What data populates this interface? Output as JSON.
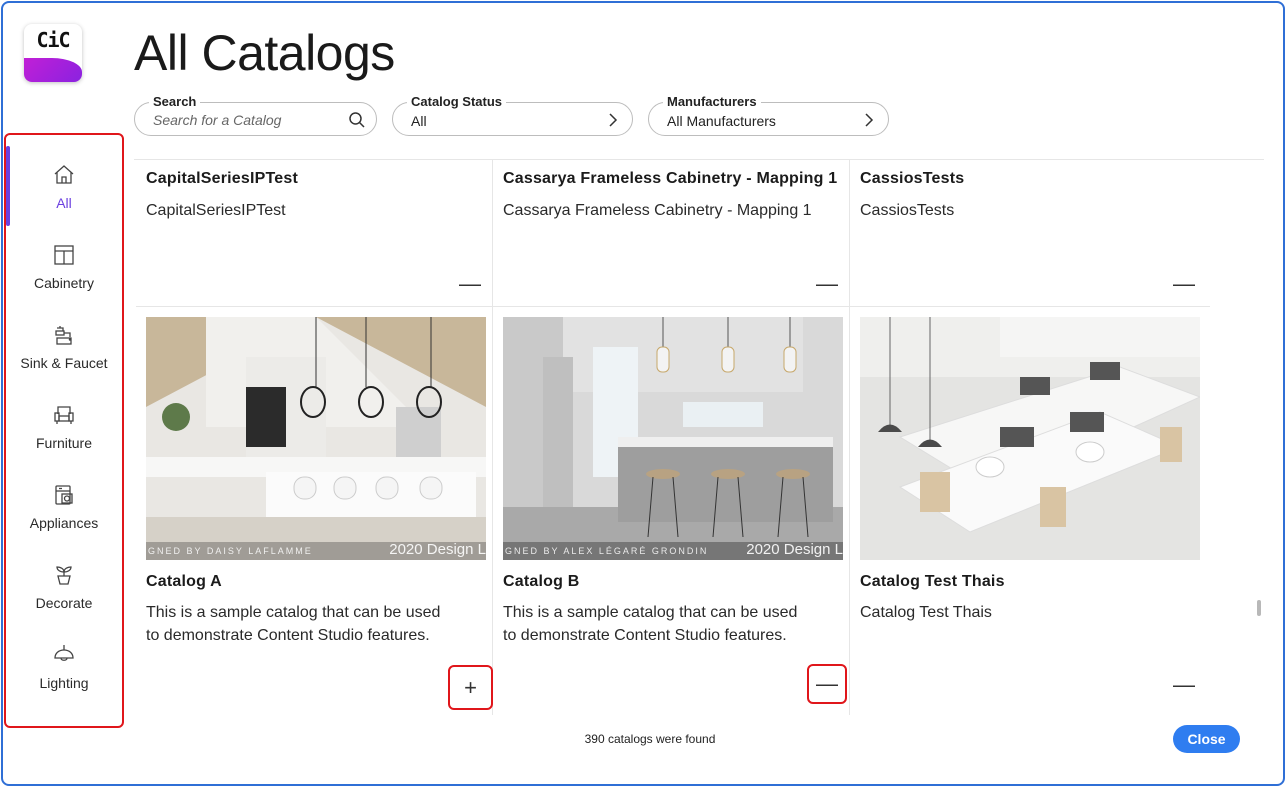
{
  "app": {
    "logo_text": "CiC"
  },
  "page": {
    "title": "All Catalogs"
  },
  "filters": {
    "search": {
      "label": "Search",
      "placeholder": "Search for a Catalog"
    },
    "status": {
      "label": "Catalog Status",
      "value": "All"
    },
    "manufacturers": {
      "label": "Manufacturers",
      "value": "All Manufacturers"
    }
  },
  "sidebar": {
    "items": [
      {
        "label": "All",
        "icon": "home-icon",
        "active": true
      },
      {
        "label": "Cabinetry",
        "icon": "cabinet-icon"
      },
      {
        "label": "Sink & Faucet",
        "icon": "faucet-icon"
      },
      {
        "label": "Furniture",
        "icon": "armchair-icon"
      },
      {
        "label": "Appliances",
        "icon": "appliance-icon"
      },
      {
        "label": "Decorate",
        "icon": "plant-icon"
      },
      {
        "label": "Lighting",
        "icon": "lamp-icon"
      }
    ]
  },
  "catalogs": [
    {
      "title": "CapitalSeriesIPTest",
      "description": "CapitalSeriesIPTest",
      "action": "—"
    },
    {
      "title": "Cassarya Frameless Cabinetry - Mapping 1",
      "description": "Cassarya Frameless Cabinetry - Mapping 1",
      "action": "—"
    },
    {
      "title": "CassiosTests",
      "description": "CassiosTests",
      "action": "—"
    },
    {
      "title": "Catalog A",
      "description": "This is a sample catalog that can be used to demonstrate Content Studio features.",
      "action": "+",
      "watermark": "GNED BY DAISY LAFLAMME",
      "brand": "2020 Design L"
    },
    {
      "title": "Catalog B",
      "description": "This is a sample catalog that can be used to demonstrate Content Studio features.",
      "action": "—",
      "watermark": "GNED BY ALEX LÉGARÉ GRONDIN",
      "brand": "2020 Design L"
    },
    {
      "title": "Catalog Test Thais",
      "description": "Catalog Test Thais",
      "action": "—"
    }
  ],
  "footer": {
    "count_text": "390 catalogs were found",
    "close_label": "Close"
  },
  "colors": {
    "accent": "#6b3fe0",
    "primary_button": "#2f7df0",
    "highlight": "#e0161b",
    "frame": "#2f6fd6"
  }
}
